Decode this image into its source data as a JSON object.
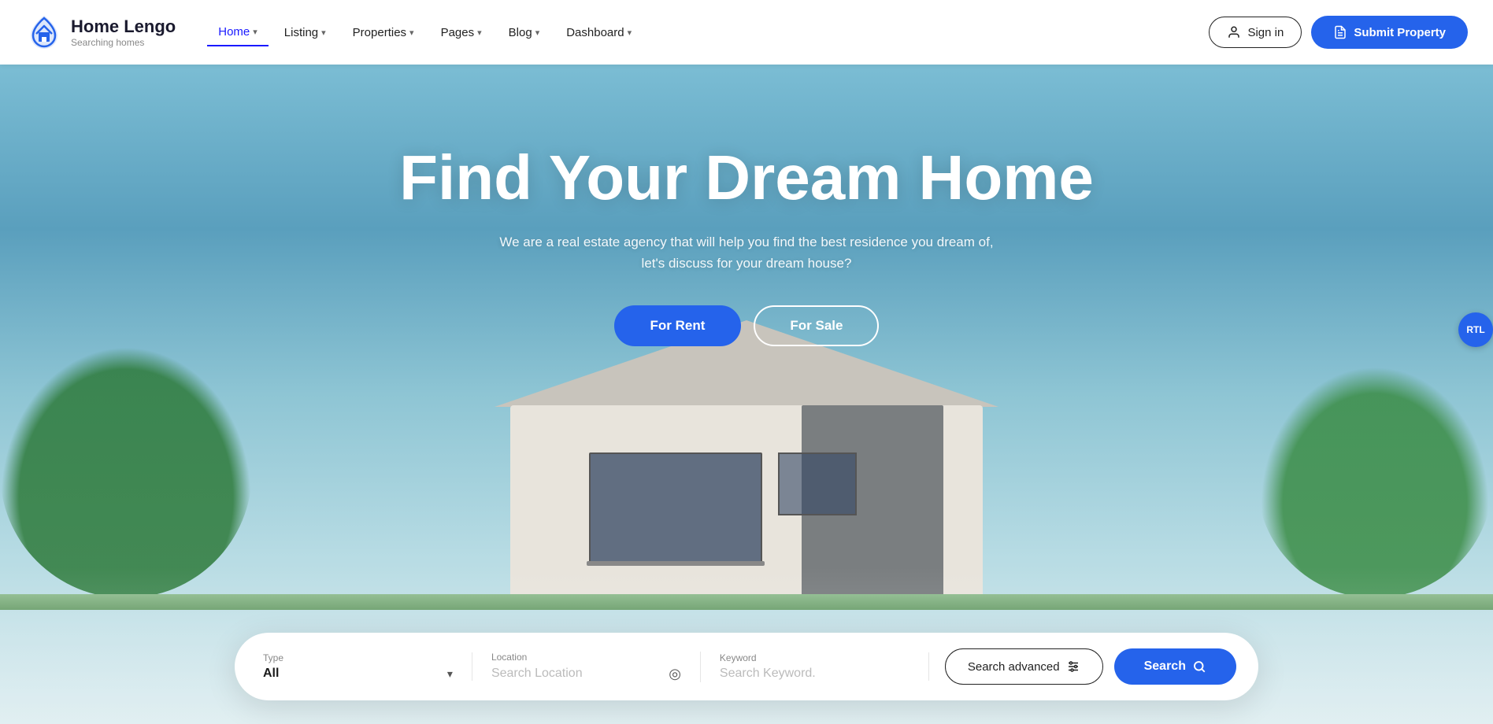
{
  "brand": {
    "name": "Home Lengo",
    "tagline": "Searching homes",
    "logo_icon": "🏠"
  },
  "nav": {
    "links": [
      {
        "label": "Home",
        "active": true,
        "has_chevron": true
      },
      {
        "label": "Listing",
        "active": false,
        "has_chevron": true
      },
      {
        "label": "Properties",
        "active": false,
        "has_chevron": true
      },
      {
        "label": "Pages",
        "active": false,
        "has_chevron": true
      },
      {
        "label": "Blog",
        "active": false,
        "has_chevron": true
      },
      {
        "label": "Dashboard",
        "active": false,
        "has_chevron": true
      }
    ],
    "signin_label": "Sign in",
    "submit_label": "Submit Property"
  },
  "hero": {
    "title": "Find Your Dream Home",
    "subtitle": "We are a real estate agency that will help you find the best residence you dream of, let's discuss for your dream house?",
    "tab_rent": "For Rent",
    "tab_sale": "For Sale"
  },
  "search": {
    "type_label": "Type",
    "type_value": "All",
    "type_placeholder": "All",
    "location_label": "Location",
    "location_placeholder": "Search Location",
    "keyword_label": "Keyword",
    "keyword_placeholder": "Search Keyword.",
    "advanced_label": "Search advanced",
    "search_label": "Search"
  },
  "rtl_button": "RTL",
  "icons": {
    "chevron_down": "▾",
    "location_target": "◎",
    "search": "🔍",
    "sliders": "⚙",
    "user": "👤",
    "document": "📄"
  }
}
